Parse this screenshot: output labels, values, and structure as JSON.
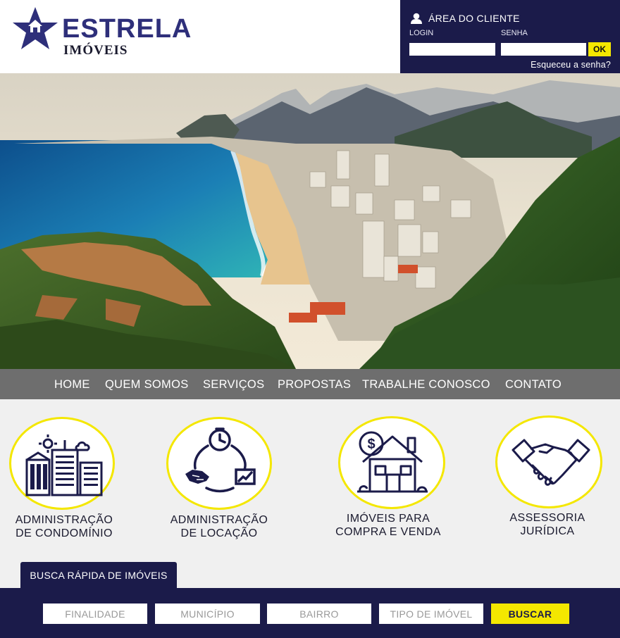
{
  "brand": {
    "name": "ESTRELA",
    "subtitle": "IMÓVEIS",
    "primary_color": "#2e2f7a",
    "accent_color": "#f4e700"
  },
  "client_area": {
    "icon": "user-icon",
    "title": "ÁREA DO CLIENTE",
    "login_label": "LOGIN",
    "login_value": "",
    "password_label": "SENHA",
    "password_value": "",
    "ok_label": "OK",
    "forgot_label": "Esqueceu a senha?"
  },
  "hero": {
    "image": "city-beach-mountains-photo"
  },
  "nav": {
    "items": [
      {
        "label": "HOME"
      },
      {
        "label": "QUEM SOMOS"
      },
      {
        "label": "SERVIÇOS"
      },
      {
        "label": "PROPOSTAS"
      },
      {
        "label": "TRABALHE CONOSCO"
      },
      {
        "label": "CONTATO"
      }
    ]
  },
  "services": [
    {
      "icon": "buildings-icon",
      "line1": "ADMINISTRAÇÃO",
      "line2": "DE CONDOMÍNIO"
    },
    {
      "icon": "rental-cycle-icon",
      "line1": "ADMINISTRAÇÃO",
      "line2": "DE LOCAÇÃO"
    },
    {
      "icon": "house-dollar-icon",
      "line1": "IMÓVEIS PARA",
      "line2": "COMPRA E VENDA"
    },
    {
      "icon": "handshake-icon",
      "line1": "ASSESSORIA",
      "line2": "JURÍDICA"
    }
  ],
  "search": {
    "tab_label": "BUSCA RÁPIDA DE IMÓVEIS",
    "fields": [
      {
        "placeholder": "FINALIDADE"
      },
      {
        "placeholder": "MUNICÍPIO"
      },
      {
        "placeholder": "BAIRRO"
      },
      {
        "placeholder": "TIPO DE IMÓVEL"
      }
    ],
    "button_label": "BUSCAR"
  }
}
